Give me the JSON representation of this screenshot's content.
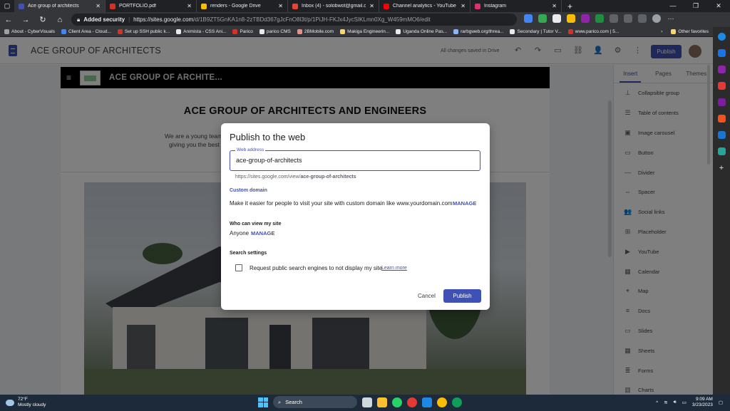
{
  "browser": {
    "tabs": [
      {
        "label": "Ace group of architects",
        "favicon_color": "#3f51b5",
        "active": true
      },
      {
        "label": "PORTFOLIO.pdf",
        "favicon_color": "#d93025",
        "active": false
      },
      {
        "label": "renders - Google Drive",
        "favicon_color": "#fbbc04",
        "active": false
      },
      {
        "label": "Inbox (4) - solobwot@gmail.com",
        "favicon_color": "#ea4335",
        "active": false
      },
      {
        "label": "Channel analytics - YouTube Studio",
        "favicon_color": "#ff0000",
        "active": false
      },
      {
        "label": "Instagram",
        "favicon_color": "#e1306c",
        "active": false
      }
    ],
    "security_label": "Added security",
    "url_prefix": "https://sites.google.com",
    "url_rest": "/d/1B9ZT5GnKA1n8-2zTBDd367gJcFnO8l3t/p/1PiJH-FKJx4JycSIKLmn0Xg_W459mMO6/edit",
    "bookmarks": [
      {
        "label": "About - CyberVisuals",
        "color": "#9aa0a6"
      },
      {
        "label": "Client Area - Cloud...",
        "color": "#4285f4"
      },
      {
        "label": "Set up SSH public k...",
        "color": "#d93025"
      },
      {
        "label": "Animista - CSS Ani...",
        "color": "#e8eaed"
      },
      {
        "label": "Parico",
        "color": "#d93025"
      },
      {
        "label": "parico CMS",
        "color": "#e8eaed"
      },
      {
        "label": "2BMobile.com",
        "color": "#f28b82"
      },
      {
        "label": "Makiga Engineerin...",
        "color": "#fdd663"
      },
      {
        "label": "Uganda Online Pas...",
        "color": "#e8eaed"
      },
      {
        "label": "rarbgweb.org/threa...",
        "color": "#8ab4f8"
      },
      {
        "label": "Secondary | Tutor V...",
        "color": "#e8eaed"
      },
      {
        "label": "www.parico.com | 5...",
        "color": "#d93025"
      }
    ],
    "other_favorites": "Other favorites"
  },
  "sites": {
    "title": "ACE GROUP OF ARCHITECTS",
    "saved_status": "All changes saved in Drive",
    "publish_label": "Publish",
    "page": {
      "nav_title": "ACE GROUP OF ARCHITE...",
      "heading": "ACE GROUP OF ARCHITECTS AND ENGINEERS",
      "intro_line1": "We are a young team",
      "intro_line2": "giving you the best"
    },
    "panel": {
      "tabs": [
        "Insert",
        "Pages",
        "Themes"
      ],
      "items": [
        {
          "label": "Collapsible group",
          "icon": "collapsible-group-icon",
          "glyph": "⊥"
        },
        {
          "label": "Table of contents",
          "icon": "table-of-contents-icon",
          "glyph": "☰"
        },
        {
          "label": "Image carousel",
          "icon": "image-carousel-icon",
          "glyph": "▣"
        },
        {
          "label": "Button",
          "icon": "button-icon",
          "glyph": "▭"
        },
        {
          "label": "Divider",
          "icon": "divider-icon",
          "glyph": "—"
        },
        {
          "label": "Spacer",
          "icon": "spacer-icon",
          "glyph": "⇔"
        },
        {
          "label": "Social links",
          "icon": "social-links-icon",
          "glyph": "👥"
        },
        {
          "label": "Placeholder",
          "icon": "placeholder-icon",
          "glyph": "⊞"
        },
        {
          "label": "YouTube",
          "icon": "youtube-icon",
          "glyph": "▶"
        },
        {
          "label": "Calendar",
          "icon": "calendar-icon",
          "glyph": "▦"
        },
        {
          "label": "Map",
          "icon": "map-icon",
          "glyph": "⌖"
        },
        {
          "label": "Docs",
          "icon": "docs-icon",
          "glyph": "≡"
        },
        {
          "label": "Slides",
          "icon": "slides-icon",
          "glyph": "▭"
        },
        {
          "label": "Sheets",
          "icon": "sheets-icon",
          "glyph": "▦"
        },
        {
          "label": "Forms",
          "icon": "forms-icon",
          "glyph": "≣"
        },
        {
          "label": "Charts",
          "icon": "charts-icon",
          "glyph": "▥"
        }
      ]
    }
  },
  "dialog": {
    "title": "Publish to the web",
    "web_address_label": "Web address",
    "web_address_value": "ace-group-of-architects",
    "url_hint_prefix": "https://sites.google.com/view/",
    "url_hint_slug": "ace-group-of-architects",
    "custom_domain_label": "Custom domain",
    "custom_domain_text": "Make it easier for people to visit your site with custom domain like www.yourdomain.com",
    "manage_label": "MANAGE",
    "who_can_view_label": "Who can view my site",
    "who_can_view_value": "Anyone",
    "search_settings_label": "Search settings",
    "search_checkbox_text": "Request public search engines to not display my site",
    "learn_more": "Learn more",
    "cancel": "Cancel",
    "publish": "Publish"
  },
  "taskbar": {
    "temperature": "72°F",
    "weather": "Mostly cloudy",
    "search_label": "Search",
    "time": "9:09 AM",
    "date": "3/23/2023"
  },
  "colors": {
    "accent": "#3f51b5",
    "overlay": "rgba(0,0,0,0.5)"
  }
}
